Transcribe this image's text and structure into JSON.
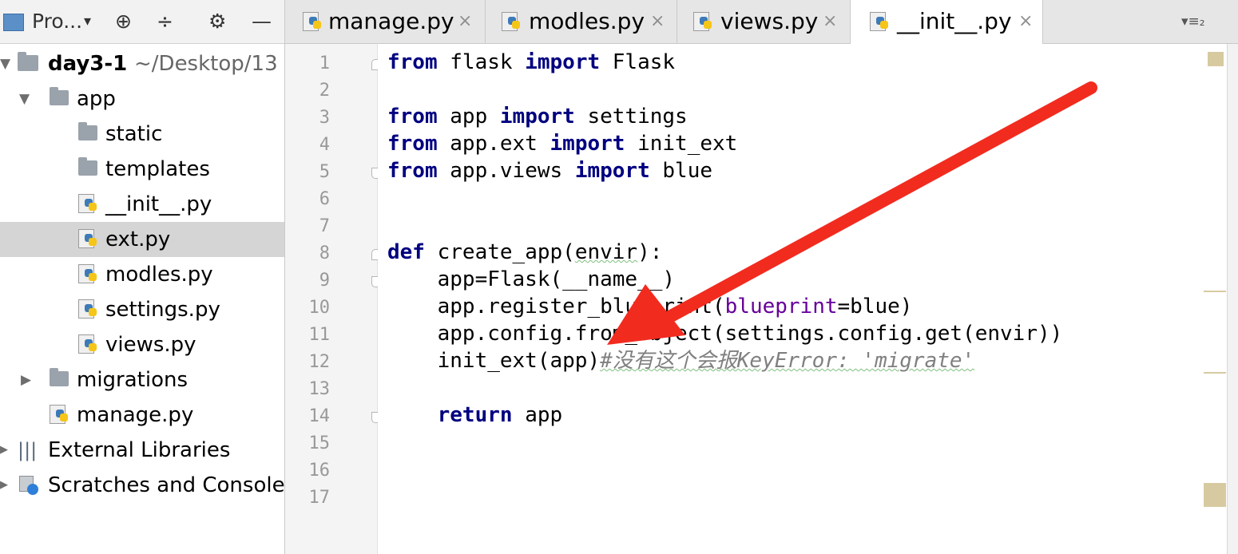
{
  "panel_header": {
    "title": "Pro...",
    "dropdown_glyph": "▾",
    "target_glyph": "⊕",
    "collapse_glyph": "÷",
    "gear_glyph": "⚙",
    "minimize_glyph": "—"
  },
  "tree": {
    "root": {
      "name": "day3-1",
      "path": "~/Desktop/13"
    },
    "app_folder": "app",
    "app_children": [
      "static",
      "templates",
      "__init__.py",
      "ext.py",
      "modles.py",
      "settings.py",
      "views.py"
    ],
    "migrations": "migrations",
    "manage": "manage.py",
    "external": "External Libraries",
    "scratches": "Scratches and Consoles",
    "selected": "ext.py"
  },
  "tabs": [
    {
      "label": "manage.py",
      "active": false
    },
    {
      "label": "modles.py",
      "active": false
    },
    {
      "label": "views.py",
      "active": false
    },
    {
      "label": "__init__.py",
      "active": true
    }
  ],
  "tab_close_glyph": "×",
  "tab_overflow_glyph": "▾≡₂",
  "editor": {
    "line_numbers": [
      "1",
      "2",
      "3",
      "4",
      "5",
      "6",
      "7",
      "8",
      "9",
      "10",
      "11",
      "12",
      "13",
      "14",
      "15",
      "16",
      "17"
    ],
    "code": {
      "l1_kw1": "from",
      "l1_mod": " flask ",
      "l1_kw2": "import",
      "l1_name": " Flask",
      "l3_kw1": "from",
      "l3_mod": " app ",
      "l3_kw2": "import",
      "l3_name": " settings",
      "l4_kw1": "from",
      "l4_mod": " app.ext ",
      "l4_kw2": "import",
      "l4_name": " init_ext",
      "l5_kw1": "from",
      "l5_mod": " app.views ",
      "l5_kw2": "import",
      "l5_name": " blue",
      "l8_kw": "def",
      "l8_fn": " create_app(",
      "l8_arg": "envir",
      "l8_end": "):",
      "l9": "    app=Flask(__name__)",
      "l10_a": "    app.register_blueprint(",
      "l10_param": "blueprint",
      "l10_b": "=blue)",
      "l11": "    app.config.from_object(settings.config.get(envir))",
      "l12_code": "    init_ext(app)",
      "l12_comment": "#没有这个会报KeyError: 'migrate'",
      "l14_indent": "    ",
      "l14_kw": "return",
      "l14_rest": " app"
    }
  },
  "colors": {
    "keyword": "#000080",
    "comment": "#808080",
    "parameter": "#660099",
    "annotation_arrow": "#f22b1f",
    "selection": "#d5d5d5"
  }
}
